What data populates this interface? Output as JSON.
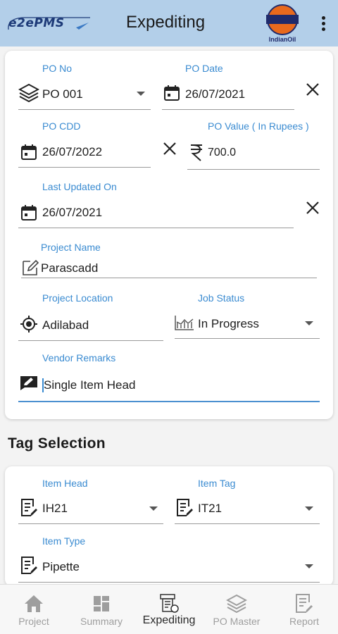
{
  "header": {
    "app_logo_text": "e2ePMS",
    "title": "Expediting",
    "brand_logo_text": "IndianOil"
  },
  "form": {
    "po_no": {
      "label": "PO No",
      "value": "PO 001"
    },
    "po_date": {
      "label": "PO Date",
      "value": "26/07/2021"
    },
    "po_cdd": {
      "label": "PO CDD",
      "value": "26/07/2022"
    },
    "po_value": {
      "label": "PO Value ( In Rupees )",
      "value": "700.0"
    },
    "last_updated": {
      "label": "Last Updated On",
      "value": "26/07/2021"
    },
    "project_name": {
      "label": "Project Name",
      "value": "Parascadd"
    },
    "project_location": {
      "label": "Project Location",
      "value": "Adilabad"
    },
    "job_status": {
      "label": "Job Status",
      "value": "In Progress"
    },
    "vendor_remarks": {
      "label": "Vendor Remarks",
      "value": "Single Item Head"
    }
  },
  "tag_selection": {
    "title": "Tag Selection",
    "item_head": {
      "label": "Item Head",
      "value": "IH21"
    },
    "item_tag": {
      "label": "Item Tag",
      "value": "IT21"
    },
    "item_type": {
      "label": "Item Type",
      "value": "Pipette"
    }
  },
  "bottom_nav": {
    "items": [
      {
        "label": "Project",
        "icon": "home-icon"
      },
      {
        "label": "Summary",
        "icon": "dashboard-icon"
      },
      {
        "label": "Expediting",
        "icon": "expediting-icon",
        "active": true
      },
      {
        "label": "PO Master",
        "icon": "layers-icon"
      },
      {
        "label": "Report",
        "icon": "report-icon"
      }
    ]
  },
  "colors": {
    "header_bg": "#b3cfe9",
    "label": "#3a8bd1",
    "active_underline": "#4b90d0",
    "brand_orange": "#e8691d",
    "brand_navy": "#1f2a6b"
  }
}
